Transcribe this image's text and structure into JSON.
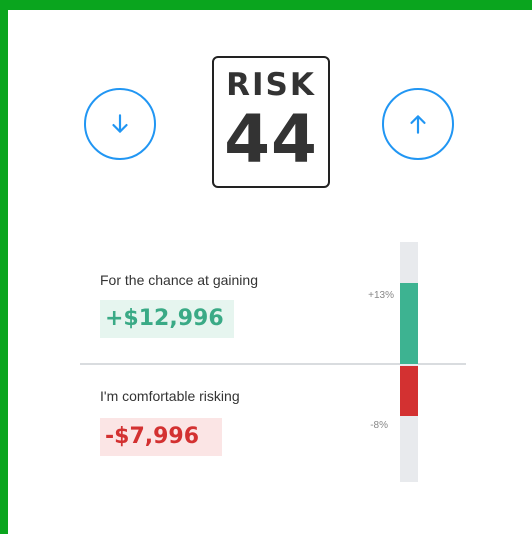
{
  "risk": {
    "label": "RISK",
    "value": "44"
  },
  "controls": {
    "decrease_icon": "arrow-down-icon",
    "increase_icon": "arrow-up-icon",
    "accent": "#2196f3"
  },
  "gain": {
    "caption": "For the chance at gaining",
    "amount": "+$12,996",
    "percent": "+13%",
    "percent_value": 13,
    "color": "#3db391"
  },
  "loss": {
    "caption": "I'm comfortable risking",
    "amount": "-$7,996",
    "percent": "-8%",
    "percent_value": 8,
    "color": "#d33131"
  },
  "colors": {
    "frame": "#0aa51e",
    "track": "#e8eaed"
  }
}
